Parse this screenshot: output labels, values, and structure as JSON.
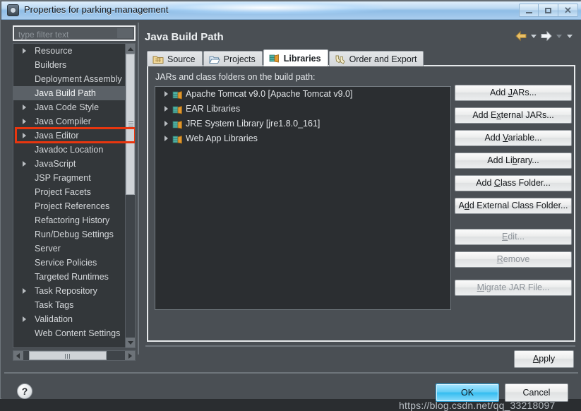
{
  "window": {
    "title": "Properties for parking-management",
    "app_icon": "properties-gear-icon",
    "minimize_label": "Minimize",
    "maximize_label": "Maximize",
    "close_label": "Close"
  },
  "sidebar": {
    "filter": {
      "value": "",
      "placeholder": "type filter text"
    },
    "items": [
      {
        "label": "Resource",
        "expandable": true,
        "selected": false
      },
      {
        "label": "Builders",
        "expandable": false,
        "selected": false
      },
      {
        "label": "Deployment Assembly",
        "expandable": false,
        "selected": false
      },
      {
        "label": "Java Build Path",
        "expandable": false,
        "selected": true
      },
      {
        "label": "Java Code Style",
        "expandable": true,
        "selected": false
      },
      {
        "label": "Java Compiler",
        "expandable": true,
        "selected": false
      },
      {
        "label": "Java Editor",
        "expandable": true,
        "selected": false
      },
      {
        "label": "Javadoc Location",
        "expandable": false,
        "selected": false
      },
      {
        "label": "JavaScript",
        "expandable": true,
        "selected": false
      },
      {
        "label": "JSP Fragment",
        "expandable": false,
        "selected": false
      },
      {
        "label": "Project Facets",
        "expandable": false,
        "selected": false
      },
      {
        "label": "Project References",
        "expandable": false,
        "selected": false
      },
      {
        "label": "Refactoring History",
        "expandable": false,
        "selected": false
      },
      {
        "label": "Run/Debug Settings",
        "expandable": false,
        "selected": false
      },
      {
        "label": "Server",
        "expandable": false,
        "selected": false
      },
      {
        "label": "Service Policies",
        "expandable": false,
        "selected": false
      },
      {
        "label": "Targeted Runtimes",
        "expandable": false,
        "selected": false
      },
      {
        "label": "Task Repository",
        "expandable": true,
        "selected": false
      },
      {
        "label": "Task Tags",
        "expandable": false,
        "selected": false
      },
      {
        "label": "Validation",
        "expandable": true,
        "selected": false
      },
      {
        "label": "Web Content Settings",
        "expandable": false,
        "selected": false
      }
    ],
    "highlight_color": "#e8360f"
  },
  "header": {
    "title": "Java Build Path",
    "back_label": "Back",
    "back_dropdown_label": "Back history",
    "forward_label": "Forward",
    "forward_dropdown_label": "Forward history",
    "menu_label": "View menu"
  },
  "tabs": [
    {
      "label": "Source",
      "icon": "source-folder-icon",
      "active": false
    },
    {
      "label": "Projects",
      "icon": "open-folder-icon",
      "active": false
    },
    {
      "label": "Libraries",
      "icon": "library-books-icon",
      "active": true
    },
    {
      "label": "Order and Export",
      "icon": "order-export-icon",
      "active": false
    }
  ],
  "main": {
    "list_label": "JARs and class folders on the build path:",
    "libraries": [
      {
        "label": "Apache Tomcat v9.0 [Apache Tomcat v9.0]",
        "icon": "library-books-icon"
      },
      {
        "label": "EAR Libraries",
        "icon": "library-books-icon"
      },
      {
        "label": "JRE System Library [jre1.8.0_161]",
        "icon": "library-books-icon"
      },
      {
        "label": "Web App Libraries",
        "icon": "library-books-icon"
      }
    ],
    "buttons": [
      {
        "label": "Add JARs...",
        "mnemonic": "J",
        "enabled": true,
        "gap": "normal"
      },
      {
        "label": "Add External JARs...",
        "mnemonic": "x",
        "enabled": true,
        "gap": "normal"
      },
      {
        "label": "Add Variable...",
        "mnemonic": "V",
        "enabled": true,
        "gap": "normal"
      },
      {
        "label": "Add Library...",
        "mnemonic": "b",
        "enabled": true,
        "gap": "normal"
      },
      {
        "label": "Add Class Folder...",
        "mnemonic": "C",
        "enabled": true,
        "gap": "normal"
      },
      {
        "label": "Add External Class Folder...",
        "mnemonic": "d",
        "enabled": true,
        "gap": "large"
      },
      {
        "label": "Edit...",
        "mnemonic": "E",
        "enabled": false,
        "gap": "normal"
      },
      {
        "label": "Remove",
        "mnemonic": "R",
        "enabled": false,
        "gap": "medium"
      },
      {
        "label": "Migrate JAR File...",
        "mnemonic": "M",
        "enabled": false,
        "gap": "normal"
      }
    ],
    "apply_label": "Apply"
  },
  "footer": {
    "help_label": "?",
    "ok_label": "OK",
    "cancel_label": "Cancel",
    "watermark": "https://blog.csdn.net/qq_33218097"
  }
}
